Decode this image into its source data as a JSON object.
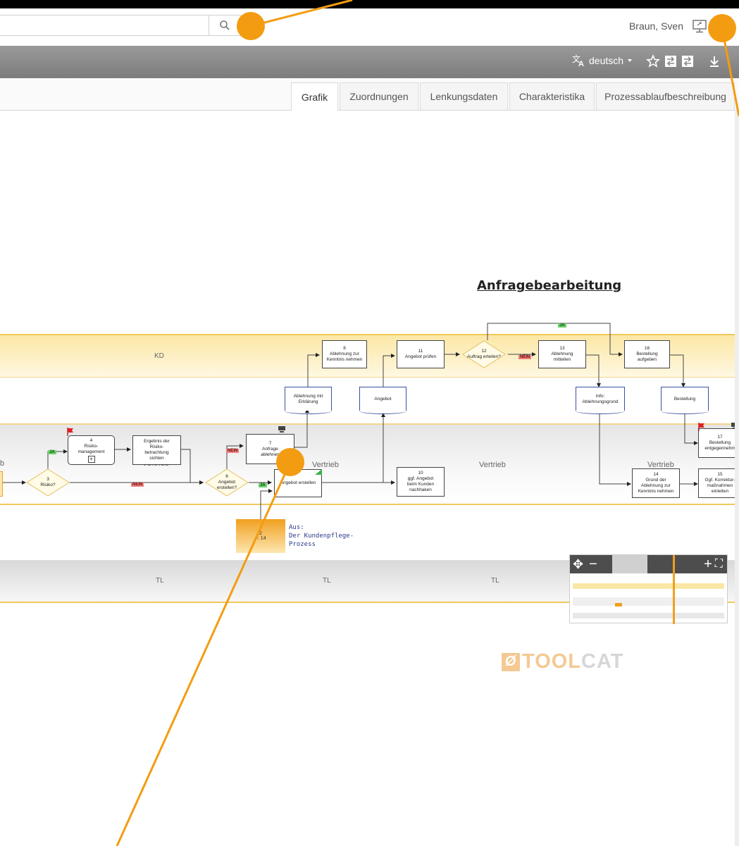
{
  "header": {
    "search_placeholder": "",
    "user_name": "Braun, Sven"
  },
  "toolbar": {
    "language": "deutsch"
  },
  "tabs": [
    {
      "label": "Grafik",
      "active": true
    },
    {
      "label": "Zuordnungen",
      "active": false
    },
    {
      "label": "Lenkungsdaten",
      "active": false
    },
    {
      "label": "Charakteristika",
      "active": false
    },
    {
      "label": "Prozessablaufbeschreibung",
      "active": false
    }
  ],
  "diagram": {
    "title": "Anfragebearbeitung",
    "lanes": {
      "kd": "KD",
      "vertrieb": "Vertrieb",
      "tl": "TL",
      "b": "b"
    },
    "nodes": {
      "n8": "8\nAblehnung zur\nKenntnis nehmen",
      "n11": "11\nAngebot prüfen",
      "n12": "12\nAuftrag erteilen?",
      "n13": "13\nAblehnung\nmitteilen",
      "n16": "16\nBestellung\naufgeben",
      "doc_ablehnung": "Ablehnung mit\nErklärung",
      "doc_angebot": "Angebot",
      "doc_info": "Info:\nAblehnungsgrund",
      "doc_bestellung": "Bestellung",
      "n4": "4\nRisiko-\nmanagement",
      "n_ergebnis": "Ergebnis der\nRisiko-\nbetrachtung\nsichten",
      "n7": "7\nAnfrage\nablehnen",
      "n17": "17\nBestellung\nentgegennehm",
      "n3": "3\nRisiko?",
      "n6": "6\nAngebot\nerstellen?",
      "n_angebot_erstellen": "Angebot erstellen",
      "n10": "10\nggf. Angebot\nbeim Kunden\nnachhaken",
      "n14": "14\nGrund der\nAblehnung zur\nKenntnis nehmen",
      "n15": "15\nGgf. Korrektur-\nmaßnahmen\neinleiten",
      "ext_num": "2",
      "ext_sub": "F. 14",
      "ext_label": "Aus:\nDer Kundenpflege-\nProzess"
    },
    "tags": {
      "ja": "JA",
      "nein": "NEIN"
    }
  },
  "logo": {
    "text_a": "TOOL",
    "text_b": "CAT"
  },
  "colors": {
    "accent": "#f39c12",
    "lane_yellow": "#fbe7a5",
    "toolbar_grey": "#8a8a8a"
  }
}
